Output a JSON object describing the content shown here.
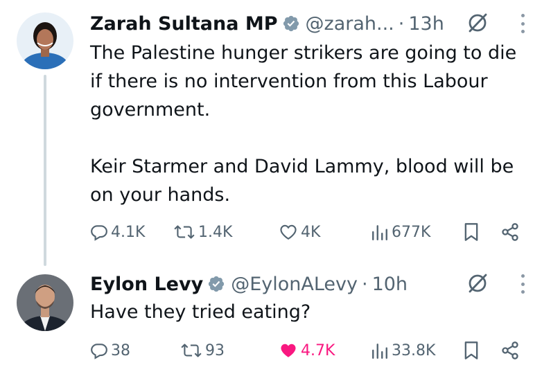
{
  "tweets": [
    {
      "author_name": "Zarah Sultana MP",
      "handle": "@zarah...",
      "time": "13h",
      "text_paragraphs": [
        "The Palestine hunger strikers are going to die if there is no intervention from this Labour government.",
        "Keir Starmer and David Lammy, blood will be on your hands."
      ],
      "replies": "4.1K",
      "reposts": "1.4K",
      "likes": "4K",
      "views": "677K",
      "liked": false
    },
    {
      "author_name": "Eylon Levy",
      "handle": "@EylonALevy",
      "time": "10h",
      "text_paragraphs": [
        "Have they tried eating?"
      ],
      "replies": "38",
      "reposts": "93",
      "likes": "4.7K",
      "views": "33.8K",
      "liked": true
    }
  ],
  "separator": "·",
  "colors": {
    "text": "#0f1419",
    "secondary": "#536471",
    "verified": "#829aab",
    "like_active": "#f91880",
    "thread_line": "#cfd9de"
  },
  "icons": [
    "reply-icon",
    "repost-icon",
    "like-icon",
    "views-icon",
    "bookmark-icon",
    "share-icon",
    "grok-icon",
    "more-icon",
    "verified-badge-icon"
  ]
}
